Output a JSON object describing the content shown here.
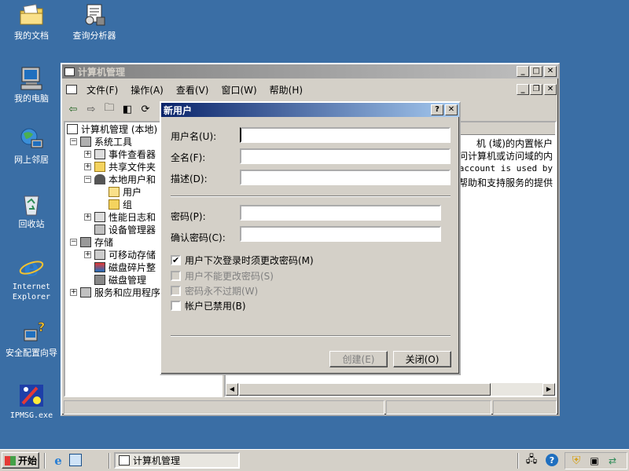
{
  "desktop": {
    "icons": [
      {
        "label": "我的文档",
        "icon": "folder-documents-icon"
      },
      {
        "label": "查询分析器",
        "icon": "query-analyzer-icon"
      },
      {
        "label": "我的电脑",
        "icon": "my-computer-icon"
      },
      {
        "label": "网上邻居",
        "icon": "network-icon"
      },
      {
        "label": "回收站",
        "icon": "recycle-bin-icon"
      },
      {
        "label_line1": "Internet",
        "label_line2": "Explorer",
        "icon": "ie-icon"
      },
      {
        "label": "安全配置向导",
        "icon": "security-wizard-icon"
      },
      {
        "label": "IPMSG.exe",
        "icon": "ipmsg-icon"
      }
    ]
  },
  "main_window": {
    "title": "计算机管理",
    "menu": [
      "文件(F)",
      "操作(A)",
      "查看(V)",
      "窗口(W)",
      "帮助(H)"
    ],
    "tree": [
      {
        "label": "计算机管理 (本地)",
        "expander": ""
      },
      {
        "label": "系统工具",
        "expander": "−"
      },
      {
        "label": "事件查看器",
        "expander": "+"
      },
      {
        "label": "共享文件夹",
        "expander": "+"
      },
      {
        "label": "本地用户和",
        "expander": "−"
      },
      {
        "label": "用户",
        "expander": ""
      },
      {
        "label": "组",
        "expander": ""
      },
      {
        "label": "性能日志和",
        "expander": "+"
      },
      {
        "label": "设备管理器",
        "expander": ""
      },
      {
        "label": "存储",
        "expander": "−"
      },
      {
        "label": "可移动存储",
        "expander": "+"
      },
      {
        "label": "磁盘碎片整",
        "expander": ""
      },
      {
        "label": "磁盘管理",
        "expander": ""
      },
      {
        "label": "服务和应用程序",
        "expander": "+"
      }
    ],
    "right_pane_lines": [
      "机 (域)的内置帐户",
      "问计算机或访问域的内",
      "r account is used by",
      "帮助和支持服务的提供"
    ]
  },
  "dialog": {
    "title": "新用户",
    "help_btn": "?",
    "close_btn": "✕",
    "fields": {
      "username_label": "用户名(U):",
      "fullname_label": "全名(F):",
      "description_label": "描述(D):",
      "password_label": "密码(P):",
      "confirm_label": "确认密码(C):",
      "username_value": "",
      "fullname_value": "",
      "description_value": "",
      "password_value": "",
      "confirm_value": ""
    },
    "checkboxes": {
      "must_change": {
        "label": "用户下次登录时须更改密码(M)",
        "checked": "✔"
      },
      "cannot_change": {
        "label": "用户不能更改密码(S)",
        "checked": ""
      },
      "never_expires": {
        "label": "密码永不过期(W)",
        "checked": ""
      },
      "disabled": {
        "label": "帐户已禁用(B)",
        "checked": ""
      }
    },
    "create_btn": "创建(E)",
    "close_button": "关闭(O)"
  },
  "taskbar": {
    "start_label": "开始",
    "task_label": "计算机管理"
  }
}
